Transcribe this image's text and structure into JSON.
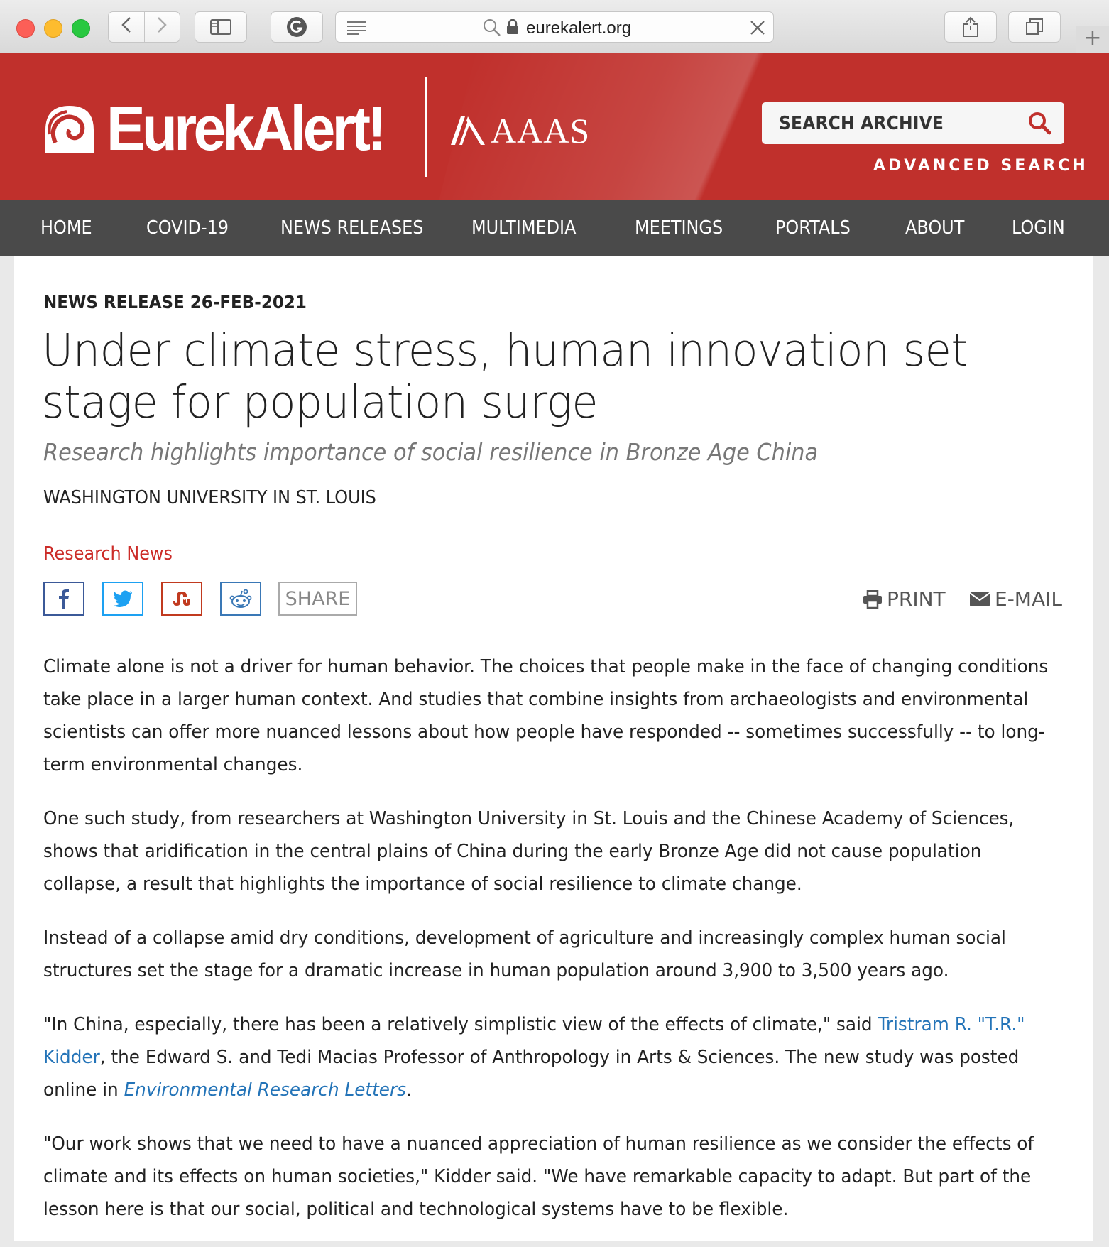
{
  "browser": {
    "url": "eurekalert.org"
  },
  "header": {
    "logo_text": "EurekAlert!",
    "partner_logo_text": "AAAS",
    "search_label": "SEARCH ARCHIVE",
    "advanced_search": "ADVANCED SEARCH"
  },
  "nav": {
    "items": [
      "HOME",
      "COVID-19",
      "NEWS RELEASES",
      "MULTIMEDIA",
      "MEETINGS",
      "PORTALS",
      "ABOUT",
      "LOGIN"
    ]
  },
  "article": {
    "release_line": "NEWS RELEASE 26-FEB-2021",
    "title": "Under climate stress, human innovation set stage for population surge",
    "subtitle": "Research highlights importance of social resilience in Bronze Age China",
    "institution": "WASHINGTON UNIVERSITY IN ST. LOUIS",
    "category": "Research News",
    "share_label": "SHARE",
    "print_label": "PRINT",
    "email_label": "E-MAIL",
    "p1": "Climate alone is not a driver for human behavior. The choices that people make in the face of changing conditions take place in a larger human context. And studies that combine insights from archaeologists and environmental scientists can offer more nuanced lessons about how people have responded -- sometimes successfully -- to long-term environmental changes.",
    "p2": "One such study, from researchers at Washington University in St. Louis and the Chinese Academy of Sciences, shows that aridification in the central plains of China during the early Bronze Age did not cause population collapse, a result that highlights the importance of social resilience to climate change.",
    "p3": "Instead of a collapse amid dry conditions, development of agriculture and increasingly complex human social structures set the stage for a dramatic increase in human population around 3,900 to 3,500 years ago.",
    "p4_a": "\"In China, especially, there has been a relatively simplistic view of the effects of climate,\" said ",
    "p4_link": "Tristram R. \"T.R.\" Kidder",
    "p4_b": ", the Edward S. and Tedi Macias Professor of Anthropology in Arts & Sciences. The new study was posted online in ",
    "p4_journal": "Environmental Research Letters",
    "p4_c": ".",
    "p5": "\"Our work shows that we need to have a nuanced appreciation of human resilience as we consider the effects of climate and its effects on human societies,\" Kidder said. \"We have remarkable capacity to adapt. But part of the lesson here is that our social, political and technological systems have to be flexible."
  },
  "colors": {
    "brand_red": "#c0302c",
    "nav_bg": "#4a4a4a",
    "link_blue": "#2474b8",
    "category_red": "#cc2d29"
  },
  "icons": [
    "close-window-icon",
    "minimize-window-icon",
    "zoom-window-icon",
    "back-icon",
    "forward-icon",
    "sidebar-icon",
    "grammarly-icon",
    "reader-icon",
    "search-icon",
    "lock-icon",
    "clear-url-icon",
    "share-icon",
    "tabs-icon",
    "new-tab-icon",
    "eurekalert-logo-icon",
    "aaas-logo-icon",
    "facebook-icon",
    "twitter-icon",
    "stumbleupon-icon",
    "reddit-icon",
    "printer-icon",
    "envelope-icon"
  ]
}
